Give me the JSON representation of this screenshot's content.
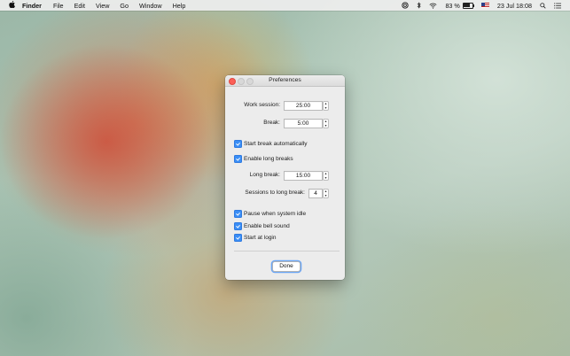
{
  "menubar": {
    "apple_icon": "apple-icon",
    "app_name": "Finder",
    "menus": [
      "File",
      "Edit",
      "View",
      "Go",
      "Window",
      "Help"
    ],
    "status": {
      "battery_percent": "83 %",
      "battery_level": 0.83,
      "datetime": "23 Jul 18:08"
    }
  },
  "window": {
    "title": "Preferences",
    "work_session": {
      "label": "Work session:",
      "value": "25:00"
    },
    "break": {
      "label": "Break:",
      "value": "5:00"
    },
    "checkboxes_top": [
      {
        "label": "Start break automatically",
        "checked": true
      },
      {
        "label": "Enable long breaks",
        "checked": true
      }
    ],
    "long_break": {
      "label": "Long break:",
      "value": "15:00"
    },
    "sessions_to_long_break": {
      "label": "Sessions to long break:",
      "value": "4"
    },
    "checkboxes_bottom": [
      {
        "label": "Pause when system idle",
        "checked": true
      },
      {
        "label": "Enable bell sound",
        "checked": true
      },
      {
        "label": "Start at login",
        "checked": true
      }
    ],
    "done_label": "Done"
  },
  "colors": {
    "accent": "#3a8ef6",
    "close_button": "#fc5f57"
  }
}
